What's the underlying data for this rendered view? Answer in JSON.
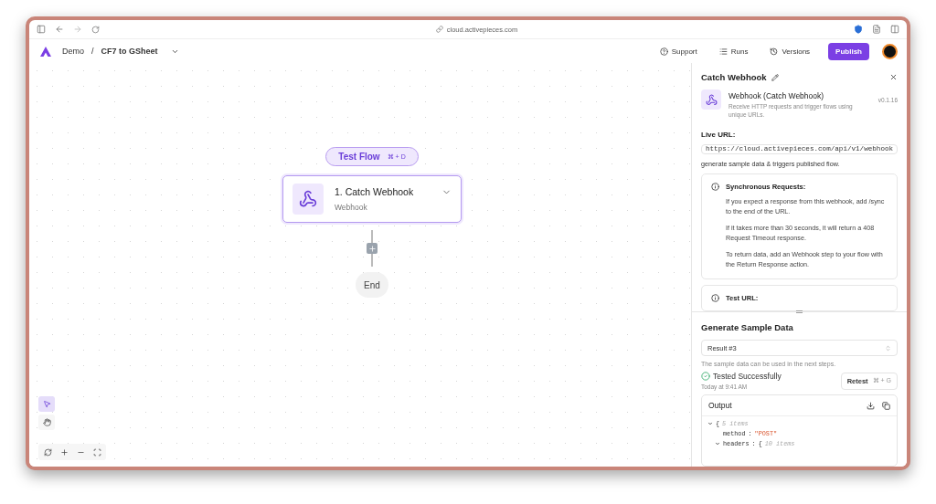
{
  "browser": {
    "url": "cloud.activepieces.com"
  },
  "header": {
    "project": "Demo",
    "separator": "/",
    "flow_name": "CF7 to GSheet",
    "actions": [
      {
        "kind": "support",
        "label": "Support"
      },
      {
        "kind": "runs",
        "label": "Runs"
      },
      {
        "kind": "versions",
        "label": "Versions"
      }
    ],
    "publish": "Publish"
  },
  "canvas": {
    "test_flow": {
      "label": "Test Flow",
      "shortcut": "⌘ + D"
    },
    "step": {
      "title": "1. Catch Webhook",
      "subtitle": "Webhook",
      "selected": true
    },
    "end": "End",
    "tools": [
      {
        "kind": "select",
        "selected": true
      },
      {
        "kind": "hand",
        "selected": false
      }
    ]
  },
  "panel": {
    "title": "Catch Webhook",
    "piece": {
      "name": "Webhook (Catch Webhook)",
      "description": "Receive HTTP requests and trigger flows using unique URLs.",
      "version": "v0.1.16"
    },
    "live_url_label": "Live URL:",
    "live_url": "https://cloud.activepieces.com/api/v1/webhook",
    "url_note": "generate sample data & triggers published flow.",
    "info_cards": [
      {
        "title": "Synchronous Requests:",
        "paragraphs": [
          "If you expect a response from this webhook, add /sync to the end of the URL.",
          "If it takes more than 30 seconds, it will return a 408 Request Timeout response.",
          "To return data, add an Webhook step to your flow with the Return Response action."
        ]
      },
      {
        "title": "Test URL:"
      }
    ],
    "sample": {
      "title": "Generate Sample Data",
      "result": "Result #3",
      "hint": "The sample data can be used in the next steps.",
      "status": "Tested Successfully",
      "time": "Today at 9:41 AM",
      "retest": "Retest",
      "retest_shortcut": "⌘ + G"
    },
    "output": {
      "title": "Output",
      "lines": [
        {
          "kind": "object",
          "value": "{",
          "count": "5 items",
          "expanded": true,
          "children": [
            {
              "kind": "field",
              "key": "method",
              "colon": ":",
              "value": "\"POST\""
            },
            {
              "kind": "object",
              "key": "headers",
              "colon": ":",
              "value": "{",
              "count": "10 items",
              "expanded": true
            }
          ]
        }
      ]
    }
  }
}
